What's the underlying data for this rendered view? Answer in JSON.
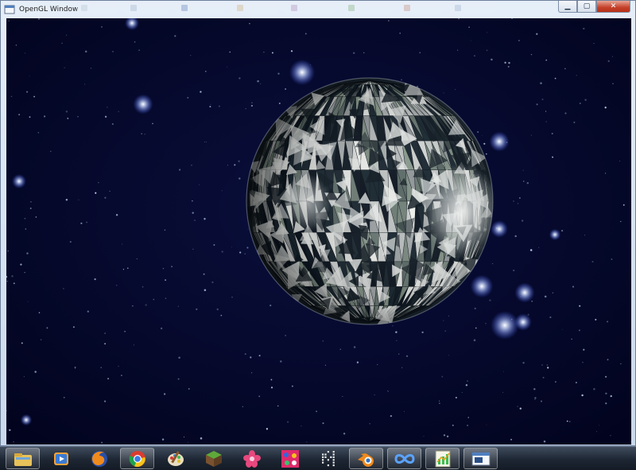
{
  "window": {
    "title": "OpenGL Window",
    "background_tabs": [
      "",
      "",
      "",
      "",
      "",
      "",
      "",
      "",
      "",
      "",
      ""
    ],
    "controls": {
      "minimize_glyph": "▁",
      "maximize_glyph": "▢",
      "close_glyph": "✕"
    }
  },
  "scene": {
    "description_icon": "textured-sphere",
    "space_color": "#03052a",
    "sphere_colors": [
      "#f1f3ef",
      "#8a9a8e",
      "#1c2a33",
      "#0d1520"
    ]
  },
  "taskbar": {
    "items": [
      {
        "name": "file-explorer-icon",
        "running": true
      },
      {
        "name": "media-player-icon",
        "running": false
      },
      {
        "name": "firefox-icon",
        "running": false
      },
      {
        "name": "chrome-icon",
        "running": true
      },
      {
        "name": "paint-icon",
        "running": false
      },
      {
        "name": "minecraft-icon",
        "running": false
      },
      {
        "name": "flower-app-icon",
        "running": false
      },
      {
        "name": "puzzle-app-icon",
        "running": false
      },
      {
        "name": "dotmatrix-app-icon",
        "running": false
      },
      {
        "name": "blender-icon",
        "running": true
      },
      {
        "name": "infinity-app-icon",
        "running": true
      },
      {
        "name": "notepad-chart-icon",
        "running": true
      },
      {
        "name": "opengl-window-icon",
        "running": true
      }
    ]
  }
}
